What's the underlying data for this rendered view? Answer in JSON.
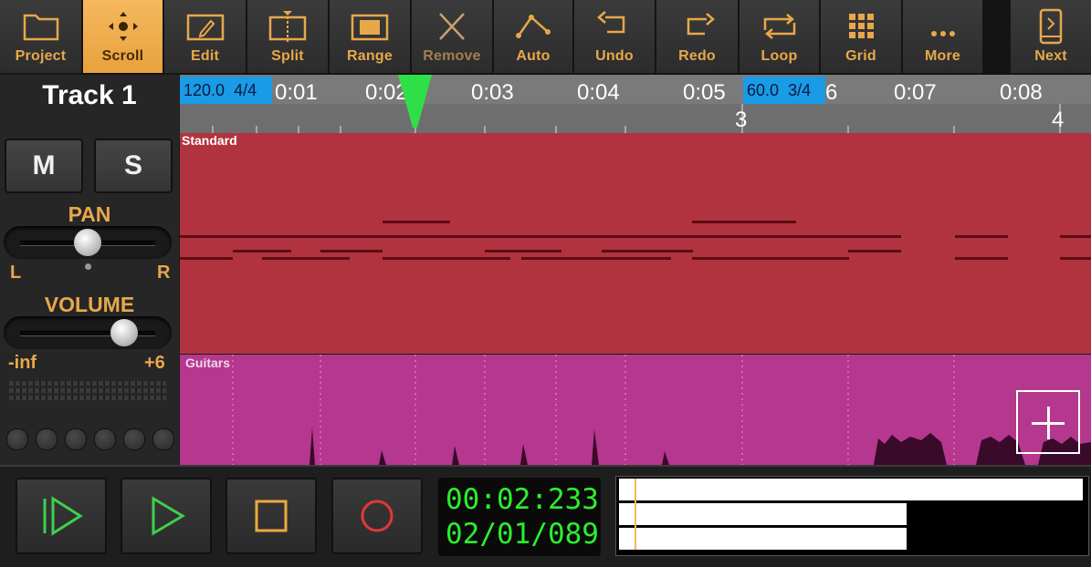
{
  "toolbar": {
    "buttons": [
      {
        "label": "Project",
        "icon": "folder-icon"
      },
      {
        "label": "Scroll",
        "icon": "move-arrows-icon",
        "active": true
      },
      {
        "label": "Edit",
        "icon": "pencil-icon"
      },
      {
        "label": "Split",
        "icon": "split-icon"
      },
      {
        "label": "Range",
        "icon": "range-icon"
      },
      {
        "label": "Remove",
        "icon": "x-icon",
        "disabled": true
      },
      {
        "label": "Auto",
        "icon": "automation-icon"
      },
      {
        "label": "Undo",
        "icon": "undo-icon"
      },
      {
        "label": "Redo",
        "icon": "redo-icon"
      },
      {
        "label": "Loop",
        "icon": "loop-icon"
      },
      {
        "label": "Grid",
        "icon": "grid-icon"
      },
      {
        "label": "More",
        "icon": "more-dots-icon"
      },
      {
        "label": "Next",
        "icon": "next-page-icon"
      }
    ]
  },
  "track_panel": {
    "title": "Track 1",
    "mute_label": "M",
    "solo_label": "S",
    "pan_label": "PAN",
    "pan_left": "L",
    "pan_right": "R",
    "pan_value": 0.5,
    "volume_label": "VOLUME",
    "volume_min": "-inf",
    "volume_max": "+6",
    "volume_value": 0.78
  },
  "ruler": {
    "times": [
      "0:01",
      "0:02",
      "0:03",
      "0:04",
      "0:05",
      "6",
      "0:07",
      "0:08"
    ],
    "bars": [
      "3",
      "4"
    ],
    "tempo_markers": [
      {
        "bpm": "120.0",
        "sig": "4/4"
      },
      {
        "bpm": "60.0",
        "sig": "3/4"
      }
    ]
  },
  "tracks": [
    {
      "name": "Standard",
      "color": "#b13340"
    },
    {
      "name": "Guitars",
      "color": "#b5378e"
    }
  ],
  "transport": {
    "time": "00:02:233",
    "position": "02/01/089",
    "buttons": [
      "play-from-start-icon",
      "play-icon",
      "stop-icon",
      "record-icon"
    ]
  },
  "levels": [
    1.0,
    0.62,
    0.62
  ]
}
